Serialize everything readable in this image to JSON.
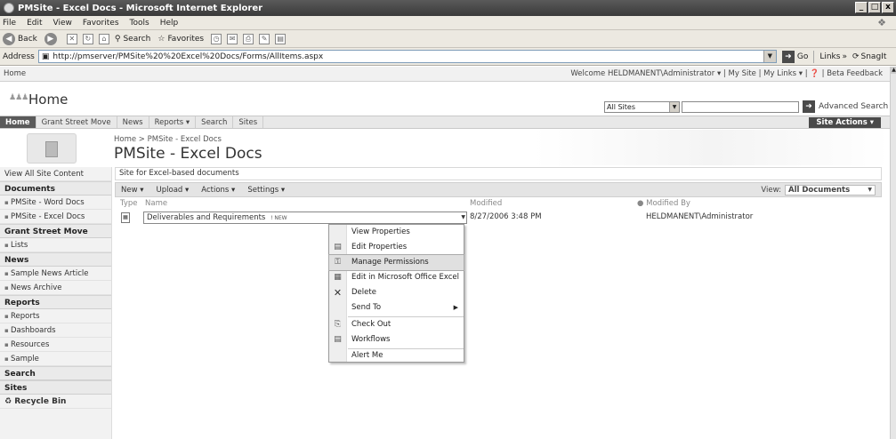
{
  "window": {
    "title": "PMSite - Excel Docs - Microsoft Internet Explorer",
    "min": "_",
    "max": "□",
    "close": "x"
  },
  "menu": [
    "File",
    "Edit",
    "View",
    "Favorites",
    "Tools",
    "Help"
  ],
  "toolbar": {
    "back": "Back",
    "search": "Search",
    "favorites": "Favorites"
  },
  "address": {
    "label": "Address",
    "url": "http://pmserver/PMSite%20%20Excel%20Docs/Forms/AllItems.aspx",
    "go": "Go",
    "links": "Links",
    "snagit": "SnagIt"
  },
  "sp_top": {
    "home": "Home",
    "welcome": "Welcome HELDMANENT\\Administrator ▾",
    "my_site": "My Site",
    "my_links": "My Links ▾",
    "beta": "Beta Feedback"
  },
  "site": {
    "title": "Home",
    "scope": "All Sites",
    "advanced_search": "Advanced Search",
    "site_actions": "Site Actions ▾"
  },
  "nav": [
    "Home",
    "Grant Street Move",
    "News",
    "Reports ▾",
    "Search",
    "Sites"
  ],
  "breadcrumb": "Home > PMSite - Excel Docs",
  "page_title": "PMSite - Excel Docs",
  "quick_launch": [
    {
      "type": "link",
      "label": "View All Site Content"
    },
    {
      "type": "head",
      "label": "Documents"
    },
    {
      "type": "item",
      "label": "PMSite - Word Docs"
    },
    {
      "type": "item",
      "label": "PMSite - Excel Docs"
    },
    {
      "type": "head",
      "label": "Grant Street Move"
    },
    {
      "type": "item",
      "label": "Lists"
    },
    {
      "type": "head",
      "label": "News"
    },
    {
      "type": "item",
      "label": "Sample News Article"
    },
    {
      "type": "item",
      "label": "News Archive"
    },
    {
      "type": "head",
      "label": "Reports"
    },
    {
      "type": "item",
      "label": "Reports"
    },
    {
      "type": "item",
      "label": "Dashboards"
    },
    {
      "type": "item",
      "label": "Resources"
    },
    {
      "type": "item",
      "label": "Sample"
    },
    {
      "type": "head",
      "label": "Search"
    },
    {
      "type": "head",
      "label": "Sites"
    },
    {
      "type": "recycle",
      "label": "Recycle Bin"
    }
  ],
  "description": "Site for Excel-based documents",
  "list_toolbar": {
    "new": "New ▾",
    "upload": "Upload ▾",
    "actions": "Actions ▾",
    "settings": "Settings ▾",
    "view_label": "View:",
    "view_value": "All Documents"
  },
  "columns": {
    "type": "Type",
    "name": "Name",
    "modified": "Modified",
    "modified_by": "Modified By"
  },
  "rows": [
    {
      "name": "Deliverables and Requirements",
      "badge": "! NEW",
      "modified": "8/27/2006 3:48 PM",
      "modified_by": "HELDMANENT\\Administrator"
    }
  ],
  "context_menu": [
    {
      "label": "View Properties",
      "icon": ""
    },
    {
      "label": "Edit Properties",
      "icon": "edit-properties-icon"
    },
    {
      "label": "Manage Permissions",
      "icon": "permissions-icon"
    },
    {
      "label": "Edit in Microsoft Office Excel",
      "icon": "excel-icon"
    },
    {
      "label": "Delete",
      "icon": "delete-icon"
    },
    {
      "label": "Send To",
      "icon": ""
    },
    {
      "label": "Check Out",
      "icon": "checkout-icon"
    },
    {
      "label": "Workflows",
      "icon": "workflows-icon"
    },
    {
      "label": "Alert Me",
      "icon": ""
    }
  ]
}
